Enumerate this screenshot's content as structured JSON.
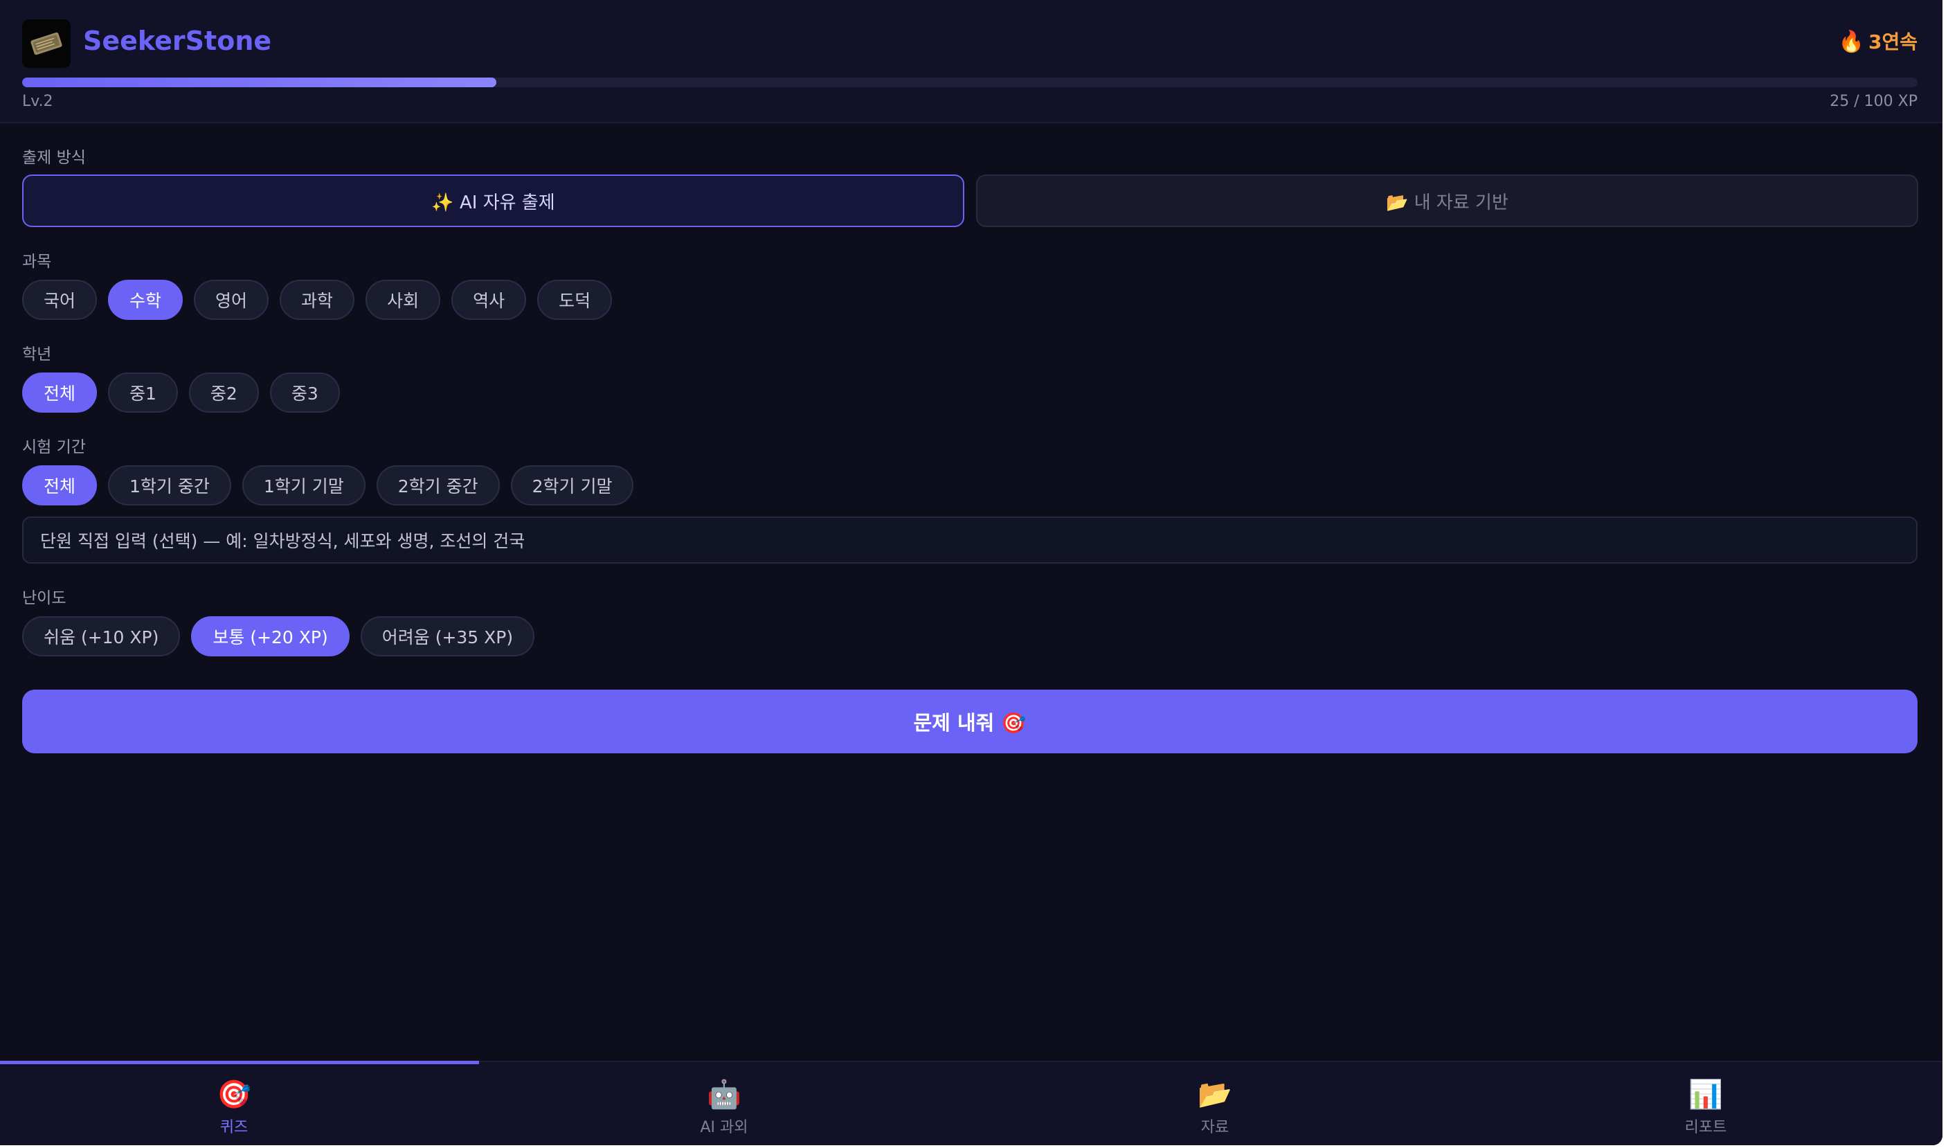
{
  "app": {
    "name": "SeekerStone",
    "streak": "3연속"
  },
  "progress": {
    "level": "Lv.2",
    "xp_text": "25 / 100 XP",
    "fraction": 0.25
  },
  "mode": {
    "label": "출제 방식",
    "ai": "✨ AI 자유 출제",
    "mine": "📂 내 자료 기반"
  },
  "subject": {
    "label": "과목",
    "options": [
      "국어",
      "수학",
      "영어",
      "과학",
      "사회",
      "역사",
      "도덕"
    ],
    "selected": "수학"
  },
  "grade": {
    "label": "학년",
    "options": [
      "전체",
      "중1",
      "중2",
      "중3"
    ],
    "selected": "전체"
  },
  "exam": {
    "label": "시험 기간",
    "options": [
      "전체",
      "1학기 중간",
      "1학기 기말",
      "2학기 중간",
      "2학기 기말"
    ],
    "selected": "전체"
  },
  "unit_input": {
    "placeholder": "단원 직접 입력 (선택) — 예: 일차방정식, 세포와 생명, 조선의 건국"
  },
  "difficulty": {
    "label": "난이도",
    "options": [
      "쉬움 (+10 XP)",
      "보통 (+20 XP)",
      "어려움 (+35 XP)"
    ],
    "selected": "보통 (+20 XP)"
  },
  "cta": {
    "label": "문제 내줘 🎯"
  },
  "nav": [
    {
      "icon": "🎯",
      "label": "퀴즈",
      "active": true
    },
    {
      "icon": "🤖",
      "label": "AI 과외",
      "active": false
    },
    {
      "icon": "📂",
      "label": "자료",
      "active": false
    },
    {
      "icon": "📊",
      "label": "리포트",
      "active": false
    }
  ],
  "colors": {
    "accent": "#6b63f5",
    "streak": "#f59e3a",
    "background": "#0d0d1c"
  }
}
